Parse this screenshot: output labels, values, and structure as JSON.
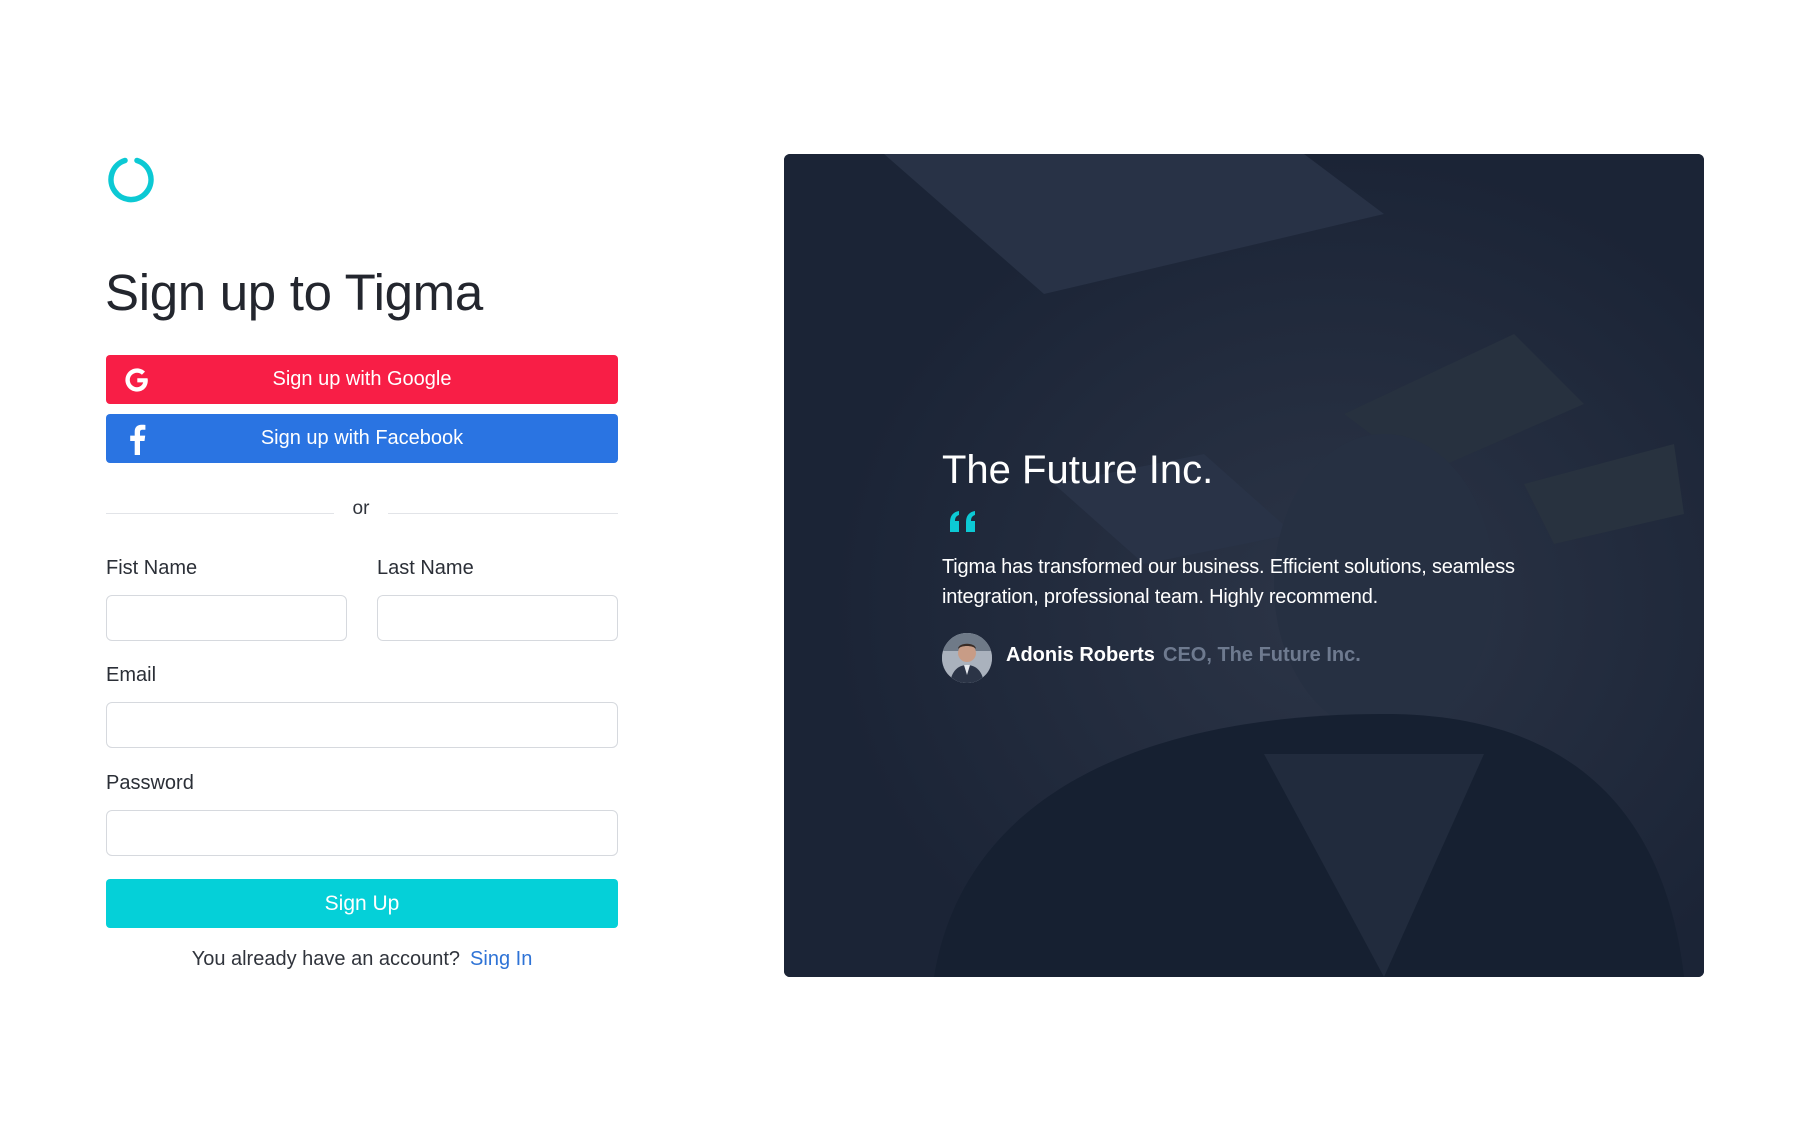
{
  "brand": {
    "logo_icon": "ring-logo-icon",
    "accent_color": "#0cc9d4"
  },
  "page": {
    "title": "Sign up to Tigma"
  },
  "social": {
    "google": {
      "label": "Sign up with Google",
      "icon": "google-icon",
      "color": "#f81e46"
    },
    "facebook": {
      "label": "Sign up with Facebook",
      "icon": "facebook-icon",
      "color": "#2a74e2"
    }
  },
  "divider": {
    "text": "or"
  },
  "form": {
    "first_name": {
      "label": "Fist Name",
      "value": ""
    },
    "last_name": {
      "label": "Last Name",
      "value": ""
    },
    "email": {
      "label": "Email",
      "value": ""
    },
    "password": {
      "label": "Password",
      "value": ""
    },
    "submit_label": "Sign Up",
    "submit_color": "#05d0d8"
  },
  "signin": {
    "prompt": "You already have an account?",
    "link_label": "Sing In"
  },
  "testimonial": {
    "company": "The Future Inc.",
    "quote_icon": "quote-icon",
    "quote": "Tigma has transformed our business. Efficient solutions, seamless integration, professional team. Highly recommend.",
    "author_name": "Adonis Roberts",
    "author_role": "CEO, The Future Inc."
  }
}
